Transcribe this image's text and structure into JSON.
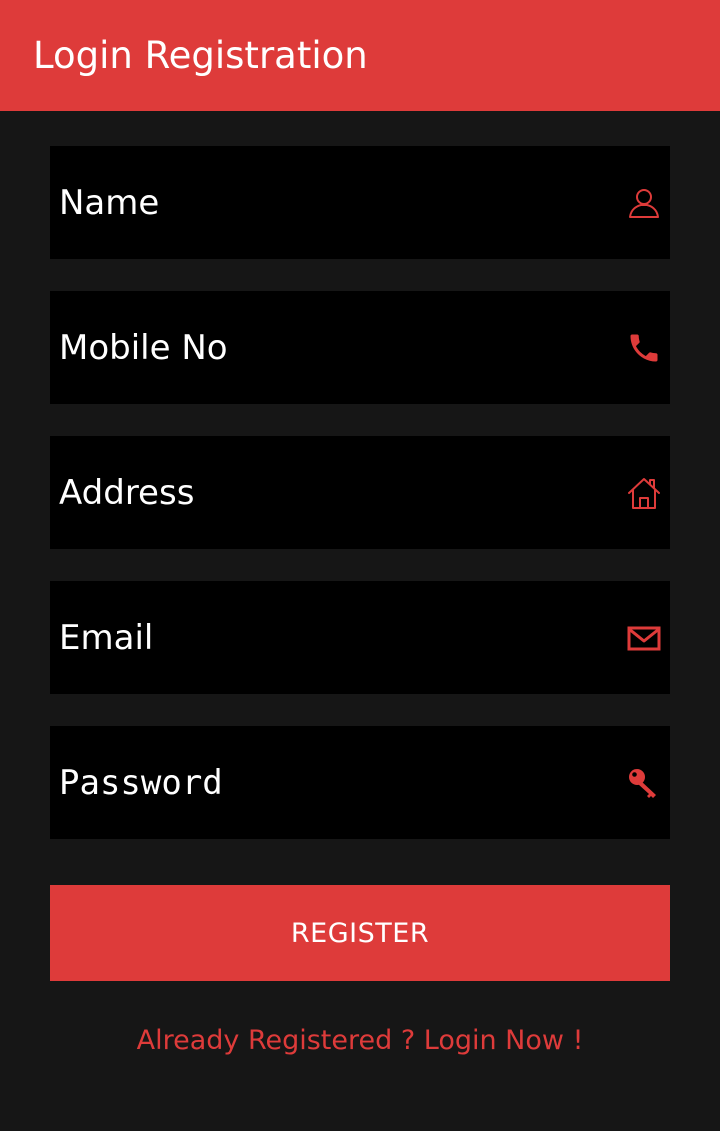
{
  "app_bar": {
    "title": "Login Registration"
  },
  "form": {
    "fields": [
      {
        "name": "name",
        "placeholder": "Name",
        "value": "",
        "icon": "user-icon"
      },
      {
        "name": "mobile",
        "placeholder": "Mobile No",
        "value": "",
        "icon": "phone-icon"
      },
      {
        "name": "address",
        "placeholder": "Address",
        "value": "",
        "icon": "home-icon"
      },
      {
        "name": "email",
        "placeholder": "Email",
        "value": "",
        "icon": "mail-icon"
      },
      {
        "name": "password",
        "placeholder": "Password",
        "value": "",
        "icon": "key-icon"
      }
    ],
    "register_label": "REGISTER",
    "login_link": "Already Registered ? Login Now !"
  },
  "colors": {
    "accent": "#de3b3a",
    "background": "#161616",
    "field_background": "#000000",
    "text": "#ffffff"
  }
}
